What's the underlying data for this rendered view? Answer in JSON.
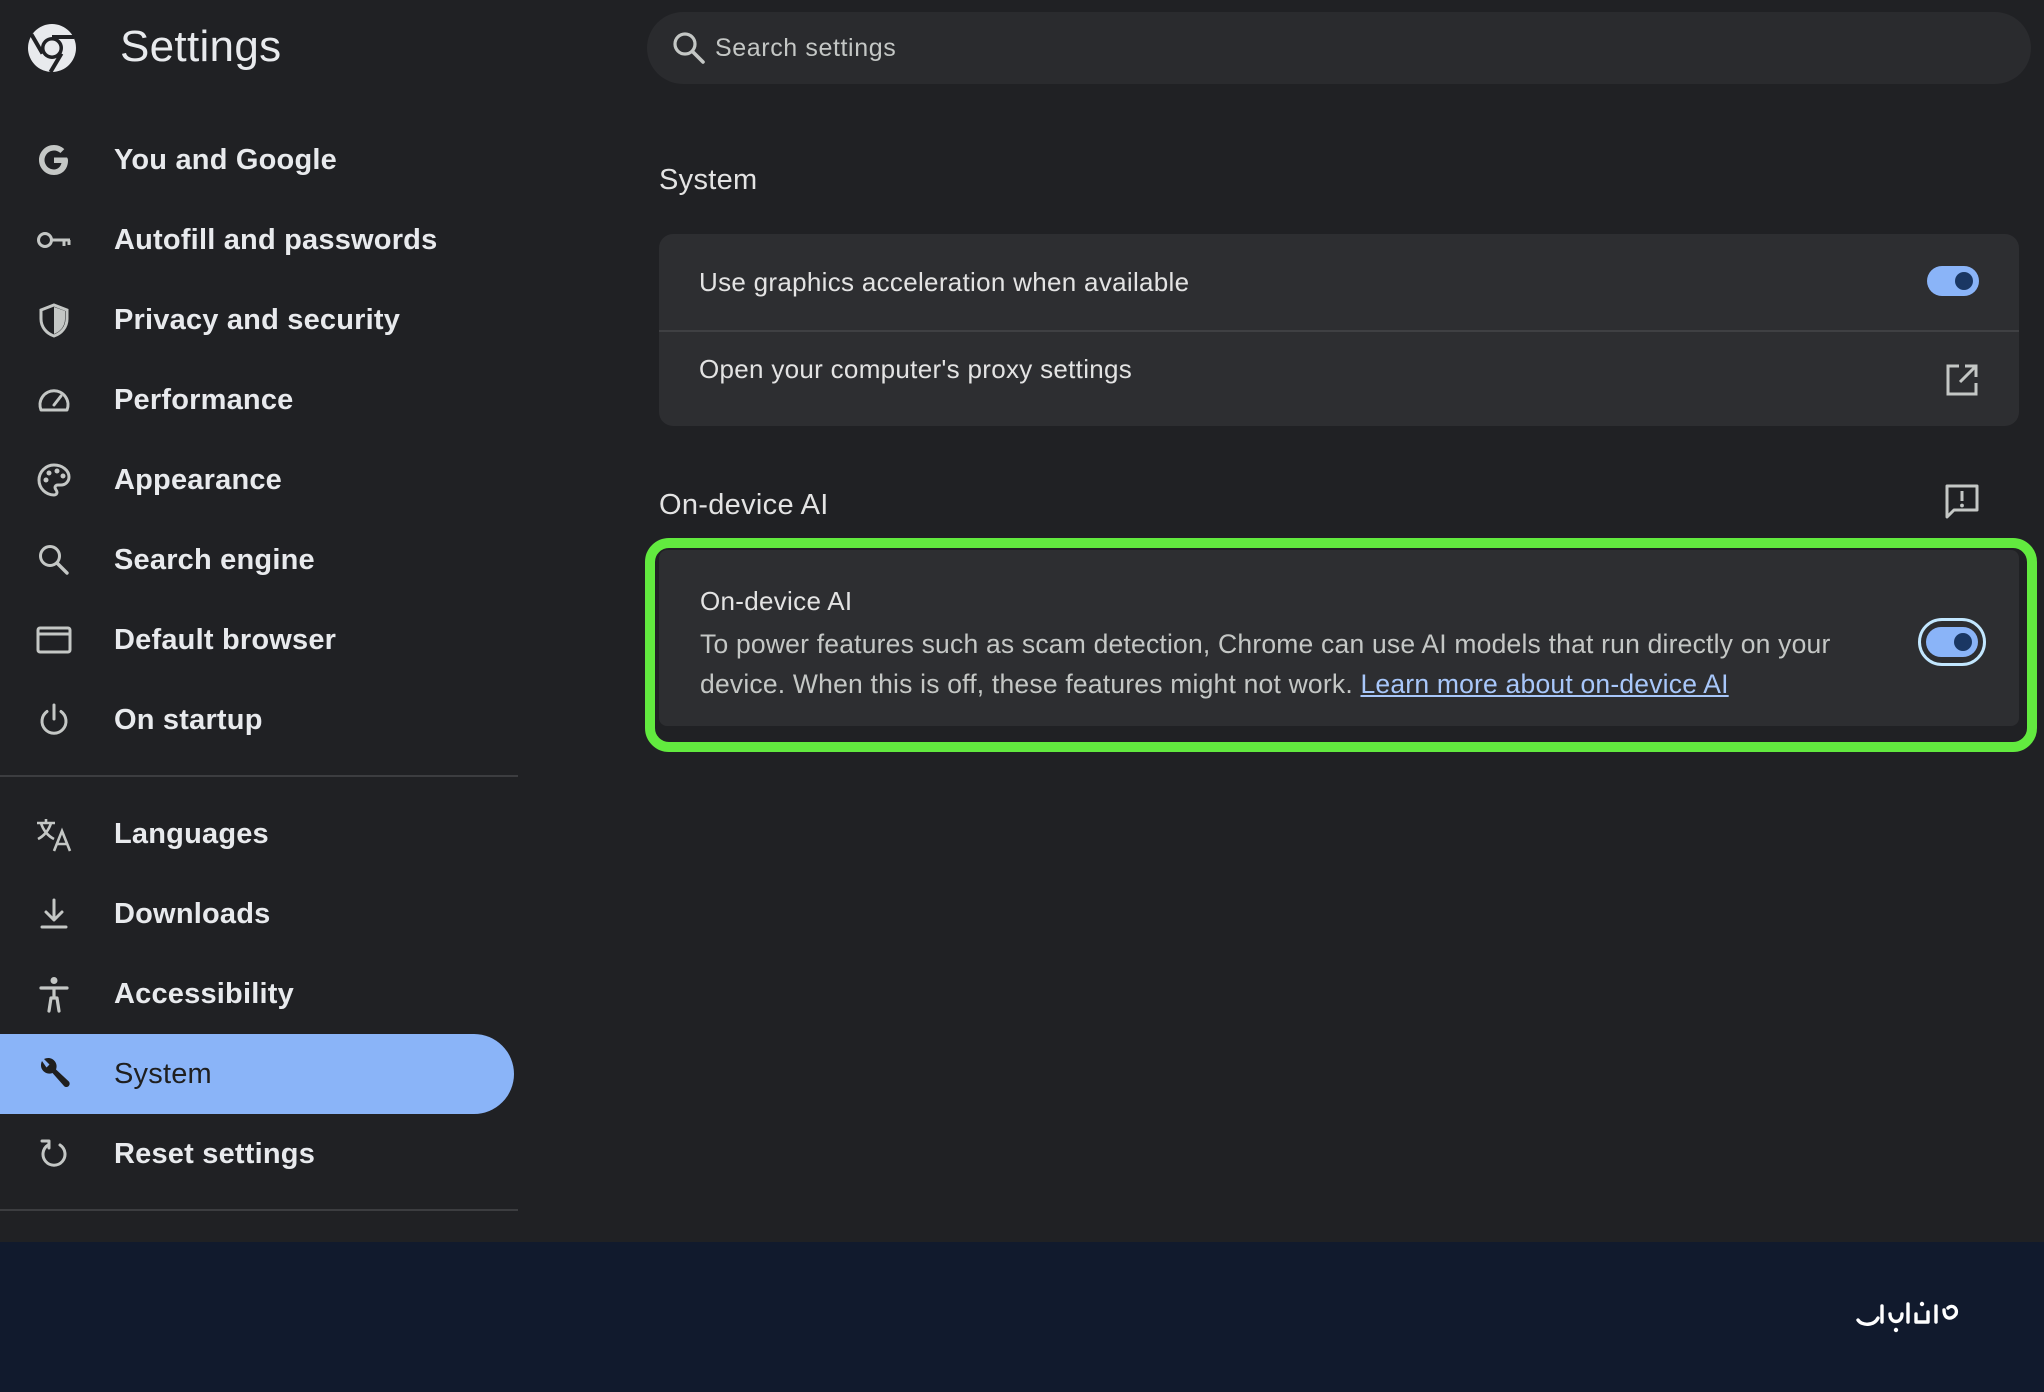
{
  "app": {
    "title": "Settings",
    "logo_icon": "chrome-logo-icon"
  },
  "search": {
    "placeholder": "Search settings",
    "icon": "search-icon"
  },
  "sidebar": {
    "items": [
      {
        "label": "You and Google",
        "icon": "google-g-icon"
      },
      {
        "label": "Autofill and passwords",
        "icon": "key-icon"
      },
      {
        "label": "Privacy and security",
        "icon": "shield-icon"
      },
      {
        "label": "Performance",
        "icon": "speedometer-icon"
      },
      {
        "label": "Appearance",
        "icon": "palette-icon"
      },
      {
        "label": "Search engine",
        "icon": "search-icon"
      },
      {
        "label": "Default browser",
        "icon": "browser-window-icon"
      },
      {
        "label": "On startup",
        "icon": "power-icon"
      },
      {
        "label": "Languages",
        "icon": "translate-icon"
      },
      {
        "label": "Downloads",
        "icon": "download-icon"
      },
      {
        "label": "Accessibility",
        "icon": "accessibility-icon"
      },
      {
        "label": "System",
        "icon": "wrench-icon",
        "active": true
      },
      {
        "label": "Reset settings",
        "icon": "reset-icon"
      }
    ]
  },
  "system_section": {
    "title": "System",
    "rows": [
      {
        "label": "Use graphics acceleration when available",
        "control": "toggle",
        "enabled": true
      },
      {
        "label": "Open your computer's proxy settings",
        "control": "external-link",
        "icon": "open-in-new-icon"
      }
    ]
  },
  "ai_section": {
    "title": "On-device AI",
    "feedback_icon": "feedback-icon",
    "card": {
      "title": "On-device AI",
      "description": "To power features such as scam detection, Chrome can use AI models that run directly on your device. When this is off, these features might not work.",
      "link_text": "Learn more about on-device AI",
      "enabled": true,
      "highlight_color": "#62ea3f"
    }
  },
  "colors": {
    "background": "#202124",
    "card": "#2d2e31",
    "accent": "#8ab4f8",
    "footer": "#111a2d"
  }
}
